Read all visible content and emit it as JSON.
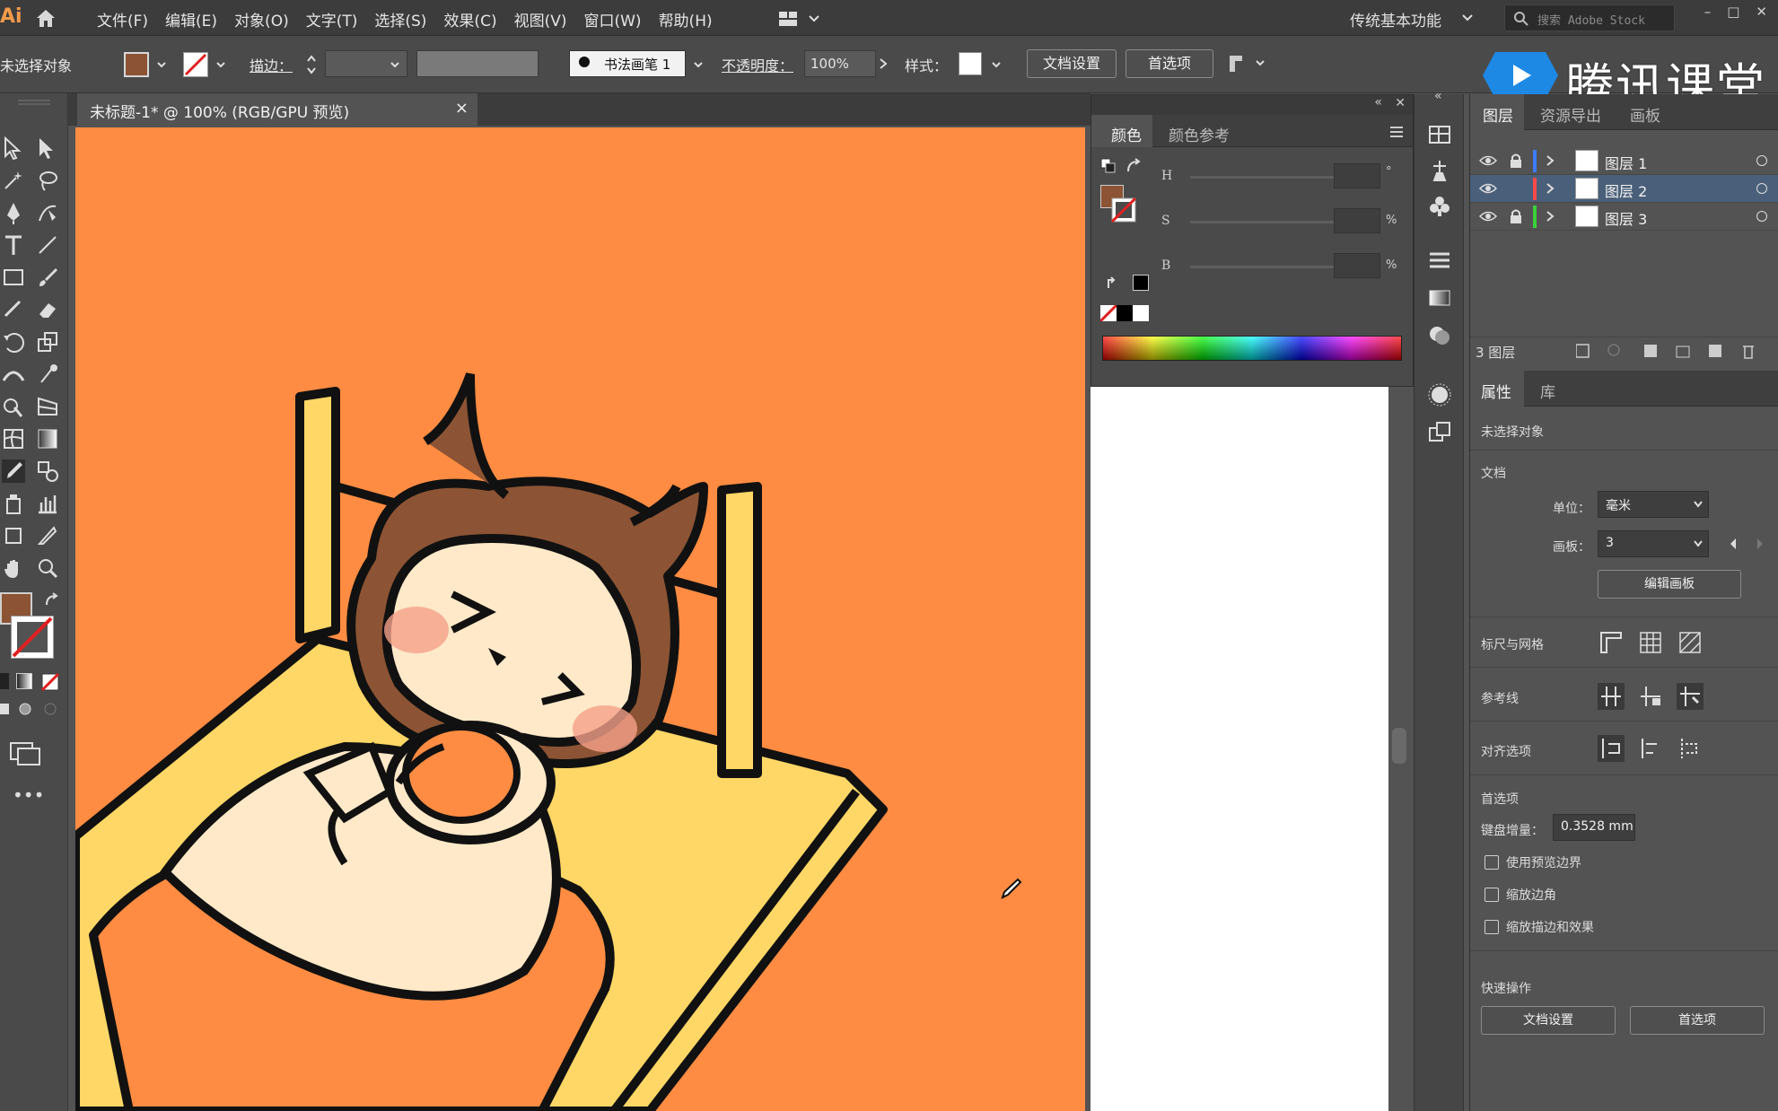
{
  "app": {
    "logo": "Ai",
    "workspace": "传统基本功能",
    "search_placeholder": "搜索 Adobe Stock"
  },
  "menu": [
    "文件(F)",
    "编辑(E)",
    "对象(O)",
    "文字(T)",
    "选择(S)",
    "效果(C)",
    "视图(V)",
    "窗口(W)",
    "帮助(H)"
  ],
  "control": {
    "selection": "未选择对象",
    "stroke_label": "描边：",
    "brush": "书法画笔 1",
    "opacity_label": "不透明度：",
    "opacity_value": "100%",
    "style_label": "样式：",
    "doc_setup": "文档设置",
    "prefs": "首选项"
  },
  "watermark": "腾讯课堂",
  "document": {
    "tab_title": "未标题-1* @ 100% (RGB/GPU 预览)",
    "close": "×"
  },
  "color_panel": {
    "tab_color": "颜色",
    "tab_guide": "颜色参考",
    "labels": {
      "h": "H",
      "s": "S",
      "b": "B"
    },
    "units": {
      "h": "°",
      "s": "%",
      "b": "%"
    },
    "fill_color": "#8c5434"
  },
  "layers_panel": {
    "tabs": [
      "图层",
      "资源导出",
      "画板"
    ],
    "layers": [
      {
        "name": "图层 1",
        "color": "#3d7cff",
        "selected": false
      },
      {
        "name": "图层 2",
        "color": "#ff4a4a",
        "selected": true
      },
      {
        "name": "图层 3",
        "color": "#3ad13a",
        "selected": false
      }
    ],
    "count": "3 图层"
  },
  "properties": {
    "tabs": [
      "属性",
      "库"
    ],
    "no_selection": "未选择对象",
    "doc_section": "文档",
    "unit_label": "单位：",
    "unit_value": "毫米",
    "artboard_label": "画板：",
    "artboard_value": "3",
    "edit_artboard": "编辑画板",
    "rulers_grid": "标尺与网格",
    "guides": "参考线",
    "snap": "对齐选项",
    "prefs_section": "首选项",
    "keyboard_inc_label": "键盘增量：",
    "keyboard_inc_value": "0.3528 mm",
    "chk_preview": "使用预览边界",
    "chk_corners": "缩放边角",
    "chk_strokes": "缩放描边和效果",
    "quick_actions": "快速操作",
    "btn_doc_setup": "文档设置",
    "btn_prefs": "首选项"
  }
}
